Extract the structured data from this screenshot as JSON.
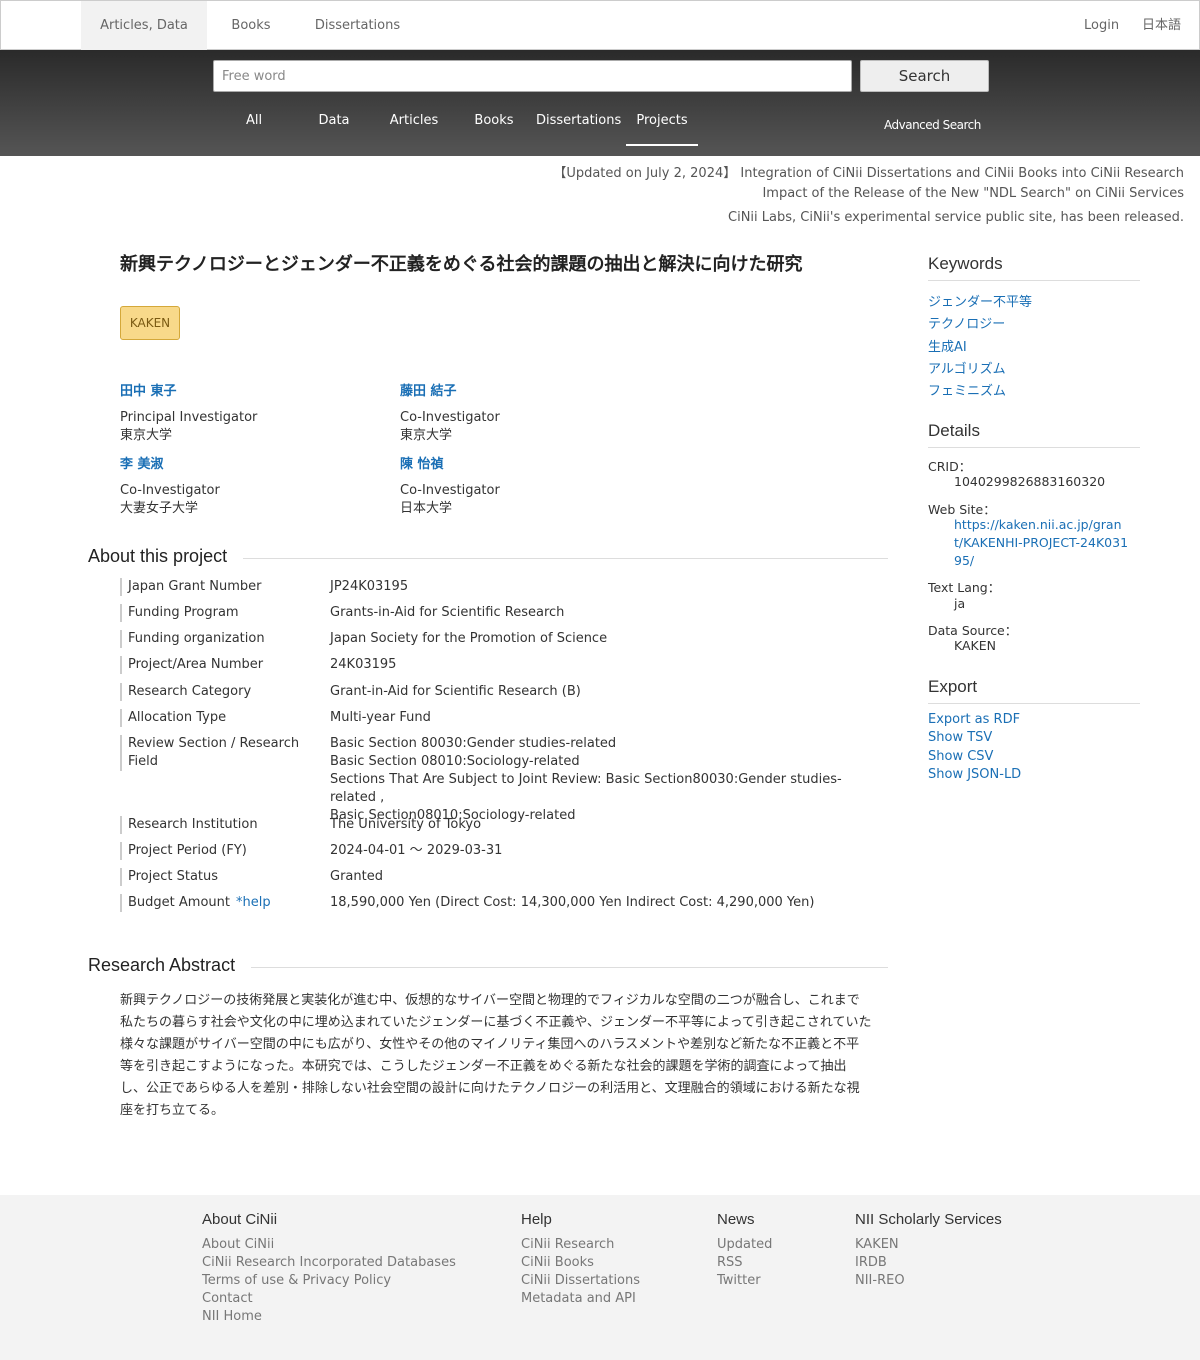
{
  "topnav": {
    "tabs": [
      "Articles, Data",
      "Books",
      "Dissertations"
    ],
    "login": "Login",
    "lang": "日本語"
  },
  "search": {
    "placeholder": "Free word",
    "button": "Search",
    "tabs": [
      "All",
      "Data",
      "Articles",
      "Books",
      "Dissertations",
      "Projects"
    ],
    "active_tab": "Projects",
    "advanced": "Advanced Search"
  },
  "notices": [
    "【Updated on July 2, 2024】 Integration of CiNii Dissertations and CiNii Books into CiNii Research",
    "Impact of the Release of the New \"NDL Search\" on CiNii Services",
    "CiNii Labs, CiNii's experimental service public site, has been released."
  ],
  "project": {
    "title": "新興テクノロジーとジェンダー不正義をめぐる社会的課題の抽出と解決に向けた研究",
    "badge": "KAKEN",
    "people": [
      {
        "name": "田中 東子",
        "role": "Principal Investigator",
        "inst": "東京大学"
      },
      {
        "name": "藤田 結子",
        "role": "Co-Investigator",
        "inst": "東京大学"
      },
      {
        "name": "李 美淑",
        "role": "Co-Investigator",
        "inst": "大妻女子大学"
      },
      {
        "name": "陳 怡禎",
        "role": "Co-Investigator",
        "inst": "日本大学"
      }
    ]
  },
  "about": {
    "heading": "About this project",
    "help": "*help",
    "rows": [
      {
        "label": "Japan Grant Number",
        "value": "JP24K03195"
      },
      {
        "label": "Funding Program",
        "value": "Grants-in-Aid for Scientific Research"
      },
      {
        "label": "Funding organization",
        "value": "Japan Society for the Promotion of Science"
      },
      {
        "label": "Project/Area Number",
        "value": "24K03195"
      },
      {
        "label": "Research Category",
        "value": "Grant-in-Aid for Scientific Research (B)"
      },
      {
        "label": "Allocation Type",
        "value": "Multi-year Fund"
      },
      {
        "label": "Review Section / Research Field",
        "value_lines": [
          "Basic Section 80030:Gender studies-related",
          "Basic Section 08010:Sociology-related",
          "Sections That Are Subject to Joint Review: Basic Section80030:Gender studies-related ,",
          "Basic Section08010:Sociology-related"
        ]
      },
      {
        "label": "Research Institution",
        "value": "The University of Tokyo"
      },
      {
        "label": "Project Period (FY)",
        "value": "2024-04-01 〜 2029-03-31"
      },
      {
        "label": "Project Status",
        "value": "Granted"
      },
      {
        "label": "Budget Amount",
        "value": "18,590,000 Yen (Direct Cost: 14,300,000 Yen Indirect Cost: 4,290,000 Yen)"
      }
    ]
  },
  "abstract": {
    "heading": "Research Abstract",
    "text": "新興テクノロジーの技術発展と実装化が進む中、仮想的なサイバー空間と物理的でフィジカルな空間の二つが融合し、これまで私たちの暮らす社会や文化の中に埋め込まれていたジェンダーに基づく不正義や、ジェンダー不平等によって引き起こされていた様々な課題がサイバー空間の中にも広がり、女性やその他のマイノリティ集団へのハラスメントや差別など新たな不正義と不平等を引き起こすようになった。本研究では、こうしたジェンダー不正義をめぐる新たな社会的課題を学術的調査によって抽出し、公正であらゆる人を差別・排除しない社会空間の設計に向けたテクノロジーの利活用と、文理融合的領域における新たな視座を打ち立てる。"
  },
  "sidebar": {
    "keywords_heading": "Keywords",
    "keywords": [
      "ジェンダー不平等",
      "テクノロジー",
      "生成AI",
      "アルゴリズム",
      "フェミニズム"
    ],
    "details_heading": "Details",
    "crid_label": "CRID：",
    "crid": "1040299826883160320",
    "website_label": "Web Site：",
    "website": "https://kaken.nii.ac.jp/grant/KAKENHI-PROJECT-24K03195/",
    "textlang_label": "Text Lang：",
    "textlang": "ja",
    "datasource_label": "Data Source：",
    "datasource": "KAKEN",
    "export_heading": "Export",
    "export_links": [
      "Export as RDF",
      "Show TSV",
      "Show CSV",
      "Show JSON-LD"
    ]
  },
  "footer": {
    "about": {
      "heading": "About CiNii",
      "links": [
        "About CiNii",
        "CiNii Research Incorporated Databases",
        "Terms of use & Privacy Policy",
        "Contact",
        "NII Home"
      ]
    },
    "help": {
      "heading": "Help",
      "links": [
        "CiNii Research",
        "CiNii Books",
        "CiNii Dissertations",
        "Metadata and API"
      ]
    },
    "news": {
      "heading": "News",
      "links": [
        "Updated",
        "RSS",
        "Twitter"
      ]
    },
    "nii": {
      "heading": "NII Scholarly Services",
      "links": [
        "KAKEN",
        "IRDB",
        "NII-REO"
      ]
    }
  }
}
